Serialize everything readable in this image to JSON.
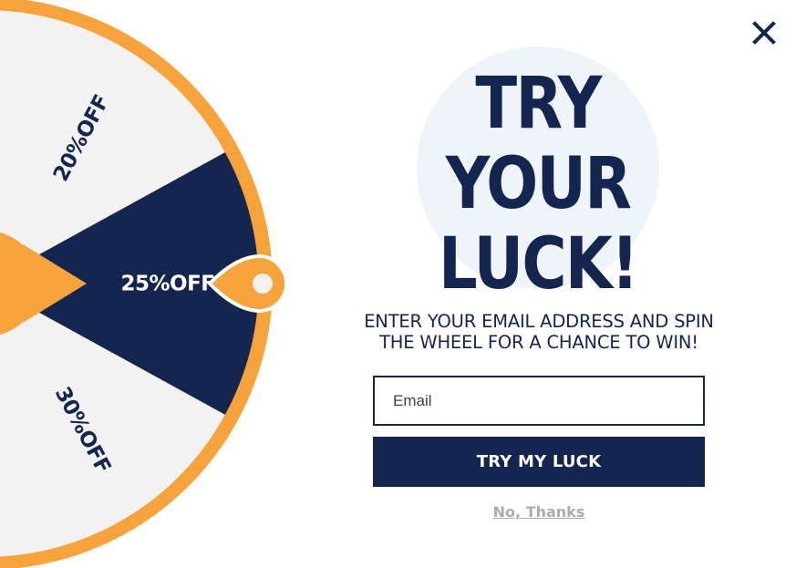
{
  "colors": {
    "navy": "#14264f",
    "orange": "#f6a33c",
    "slice_light": "#f2f2f2",
    "halo": "#eef4f8",
    "muted_link": "#a9adb3"
  },
  "wheel": {
    "slices": [
      {
        "label": "20%OFF",
        "fill": "light"
      },
      {
        "label": "25%OFF",
        "fill": "navy"
      },
      {
        "label": "30%OFF",
        "fill": "light"
      }
    ],
    "selected": "25%OFF"
  },
  "close": {
    "icon": "close-icon"
  },
  "headline": {
    "line1": "TRY YOUR",
    "line2": "LUCK!"
  },
  "subtitle": {
    "line1": "ENTER YOUR EMAIL ADDRESS AND SPIN",
    "line2": "THE WHEEL FOR A CHANCE TO WIN!"
  },
  "email": {
    "placeholder": "Email",
    "value": ""
  },
  "submit": {
    "label": "TRY MY LUCK"
  },
  "decline": {
    "label": "No, Thanks"
  }
}
